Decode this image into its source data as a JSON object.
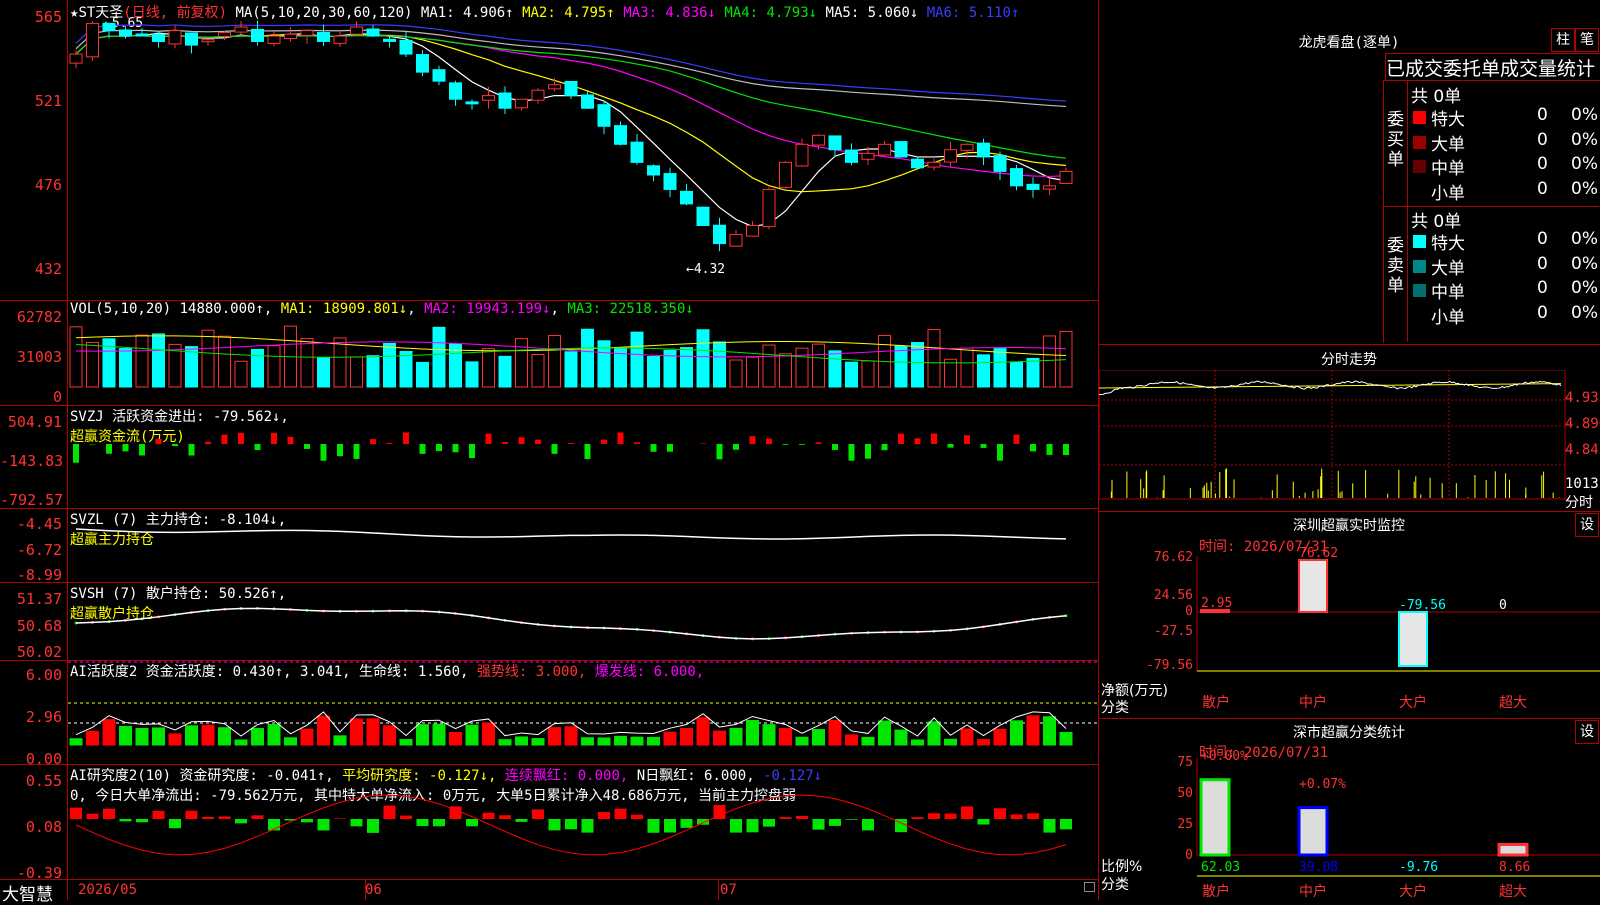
{
  "main_header": {
    "star": "★",
    "stock_name": "ST天圣",
    "mode": "(日线, 前复权)",
    "ma_label": "MA(5,10,20,30,60,120)",
    "ma1": "MA1: 4.906↑",
    "ma2": "MA2: 4.795↑",
    "ma3": "MA3: 4.836↓",
    "ma4": "MA4: 4.793↓",
    "ma5": "MA5: 5.060↓",
    "ma6": "MA6: 5.110↑",
    "high_mark": "5.65",
    "low_mark": "4.32",
    "axis": [
      "565",
      "521",
      "476",
      "432"
    ]
  },
  "volume_panel": {
    "label": "VOL(5,10,20)",
    "value": "14880.000↑",
    "ma1": "MA1: 18909.801↓",
    "ma2": "MA2: 19943.199↓",
    "ma3": "MA3: 22518.350↓",
    "axis": [
      "62782",
      "31003",
      "0"
    ]
  },
  "svzj_panel": {
    "label": "SVZJ  活跃资金进出: -79.562↓,",
    "sublabel": "超赢资金流(万元)",
    "axis": [
      "504.91",
      "-143.83",
      "-792.57"
    ]
  },
  "svzl_panel": {
    "label": "SVZL (7) 主力持仓: -8.104↓,",
    "sublabel": "超赢主力持仓",
    "axis": [
      "-4.45",
      "-6.72",
      "-8.99"
    ]
  },
  "svsh_panel": {
    "label": "SVSH (7) 散户持仓: 50.526↑,",
    "sublabel": "超赢散户持仓",
    "axis": [
      "51.37",
      "50.68",
      "50.02"
    ]
  },
  "ai_active_panel": {
    "label": "AI活跃度2 资金活跃度: 0.430↑, 3.041, 生命线: 1.560,",
    "strong": "强势线: 3.000,",
    "burst": "爆发线: 6.000,",
    "axis": [
      "6.00",
      "2.96",
      "0.00"
    ]
  },
  "ai_research_panel": {
    "label": "AI研究度2(10) 资金研究度: -0.041↑,",
    "avg": "平均研究度: -0.127↓,",
    "cont": "连续飘红: 0.000,",
    "nday": "N日飘红: 6.000,",
    "last": "-0.127↓",
    "summary": "0, 今日大单净流出: -79.562万元, 其中特大单净流入: 0万元, 大单5日累计净入48.686万元, 当前主力控盘弱",
    "axis": [
      "0.55",
      "0.08",
      "-0.39"
    ]
  },
  "bottom_bar": {
    "brand": "大智慧",
    "date1": "2026/05",
    "date2": "06",
    "date3": "07"
  },
  "dragon_tiger": {
    "title": "龙虎看盘(逐单)",
    "btn1": "柱",
    "btn2": "笔",
    "subtitle": "已成交委托单成交量统计",
    "buy_side": "委买单",
    "sell_side": "委卖单",
    "buy_total": "共 0单",
    "sell_total": "共 0单",
    "buy_rows": [
      {
        "name": "特大",
        "count": "0",
        "pct": "0%",
        "color": "#ff0000"
      },
      {
        "name": "大单",
        "count": "0",
        "pct": "0%",
        "color": "#990000"
      },
      {
        "name": "中单",
        "count": "0",
        "pct": "0%",
        "color": "#660000"
      },
      {
        "name": "小单",
        "count": "0",
        "pct": "0%",
        "color": "#000000"
      }
    ],
    "sell_rows": [
      {
        "name": "特大",
        "count": "0",
        "pct": "0%",
        "color": "#00ffff"
      },
      {
        "name": "大单",
        "count": "0",
        "pct": "0%",
        "color": "#008888"
      },
      {
        "name": "中单",
        "count": "0",
        "pct": "0%",
        "color": "#007070"
      },
      {
        "name": "小单",
        "count": "0",
        "pct": "0%",
        "color": "#000000"
      }
    ]
  },
  "intraday": {
    "title": "分时走势",
    "axis": [
      "4.935",
      "4.890",
      "4.845"
    ],
    "vol": "1013",
    "vol_label": "分时"
  },
  "monitor": {
    "title": "深圳超赢实时监控",
    "btn": "设",
    "time": "时间: 2026/07/31",
    "axis": [
      "76.62",
      "24.56",
      "0",
      "-27.5",
      "-79.56"
    ],
    "ylabel1": "净额(万元)",
    "ylabel2": "分类",
    "values": [
      "2.95",
      "76.62",
      "-79.56",
      "0"
    ],
    "cats": [
      "散户",
      "中户",
      "大户",
      "超大"
    ]
  },
  "classify": {
    "title": "深市超赢分类统计",
    "btn": "设",
    "time": "时间: 2026/07/31",
    "axis": [
      "75",
      "50",
      "25",
      "0"
    ],
    "ylabel1": "比例%",
    "ylabel2": "分类",
    "top_labels": [
      "+0.00%",
      "+0.07%"
    ],
    "values": [
      "62.03",
      "39.08",
      "-9.76",
      "8.66"
    ],
    "cats": [
      "散户",
      "中户",
      "大户",
      "超大"
    ]
  },
  "colors": {
    "up": "#ff3232",
    "down": "#00ffff",
    "grid": "#b00000"
  }
}
